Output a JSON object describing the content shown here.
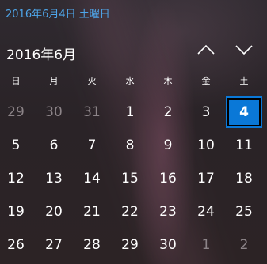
{
  "header": {
    "date_link": "2016年6月4日 土曜日",
    "month_title": "2016年6月",
    "prev_icon": "chevron-up-icon",
    "next_icon": "chevron-down-icon"
  },
  "colors": {
    "accent": "#0a78d7",
    "link": "#4ea6ea",
    "dim_text": "#8c8488"
  },
  "weekdays": [
    "日",
    "月",
    "火",
    "水",
    "木",
    "金",
    "土"
  ],
  "weeks": [
    [
      "29",
      "30",
      "31",
      "1",
      "2",
      "3",
      "4"
    ],
    [
      "5",
      "6",
      "7",
      "8",
      "9",
      "10",
      "11"
    ],
    [
      "12",
      "13",
      "14",
      "15",
      "16",
      "17",
      "18"
    ],
    [
      "19",
      "20",
      "21",
      "22",
      "23",
      "24",
      "25"
    ],
    [
      "26",
      "27",
      "28",
      "29",
      "30",
      "1",
      "2"
    ]
  ],
  "selected_date": "4",
  "other_month_days": {
    "leading": [
      "29",
      "30",
      "31"
    ],
    "trailing": [
      "1",
      "2"
    ]
  }
}
